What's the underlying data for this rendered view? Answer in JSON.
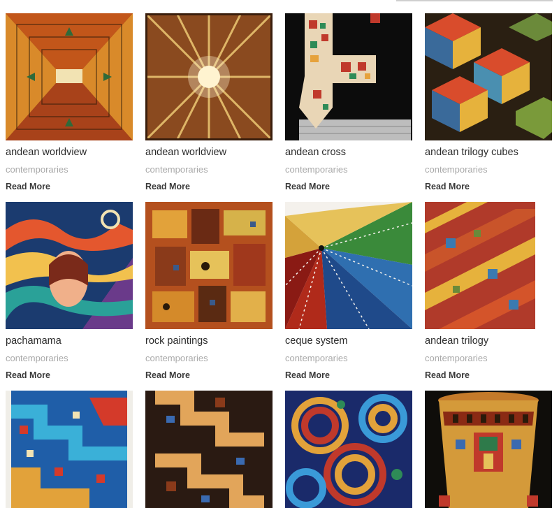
{
  "gallery": {
    "items": [
      {
        "title": "andean worldview",
        "category": "contemporaries",
        "read_more": "Read More",
        "image": "weaving-andean-worldview-1"
      },
      {
        "title": "andean worldview",
        "category": "contemporaries",
        "read_more": "Read More",
        "image": "weaving-andean-worldview-2"
      },
      {
        "title": "andean cross",
        "category": "contemporaries",
        "read_more": "Read More",
        "image": "weaving-andean-cross"
      },
      {
        "title": "andean trilogy cubes",
        "category": "contemporaries",
        "read_more": "Read More",
        "image": "weaving-andean-trilogy-cubes"
      },
      {
        "title": "pachamama",
        "category": "contemporaries",
        "read_more": "Read More",
        "image": "weaving-pachamama"
      },
      {
        "title": "rock paintings",
        "category": "contemporaries",
        "read_more": "Read More",
        "image": "weaving-rock-paintings"
      },
      {
        "title": "ceque system",
        "category": "contemporaries",
        "read_more": "Read More",
        "image": "weaving-ceque-system"
      },
      {
        "title": "andean trilogy",
        "category": "contemporaries",
        "read_more": "Read More",
        "image": "weaving-andean-trilogy"
      },
      {
        "title": "",
        "category": "",
        "read_more": "",
        "image": "weaving-blue-stepped-pattern"
      },
      {
        "title": "",
        "category": "",
        "read_more": "",
        "image": "weaving-brown-stepped-pattern"
      },
      {
        "title": "",
        "category": "",
        "read_more": "",
        "image": "weaving-spiral-pattern"
      },
      {
        "title": "",
        "category": "",
        "read_more": "",
        "image": "weaving-kero-vessel"
      }
    ]
  },
  "colors": {
    "title": "#2b2b2b",
    "category": "#a9a9a9",
    "read_more": "#3a3a3a"
  }
}
